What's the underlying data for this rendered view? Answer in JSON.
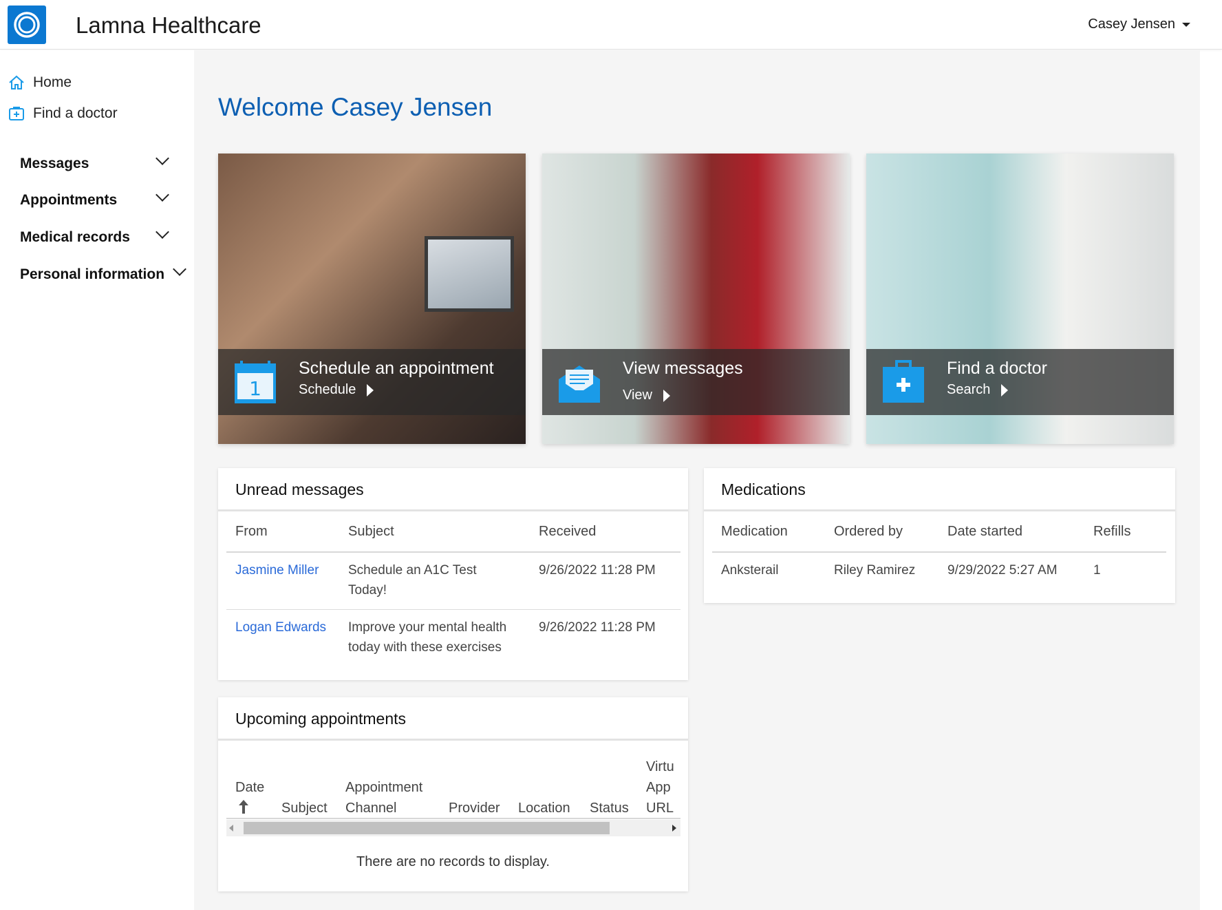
{
  "app": {
    "title": "Lamna Healthcare",
    "user": "Casey Jensen"
  },
  "sidebar": {
    "home": "Home",
    "find_doctor": "Find a doctor",
    "sections": [
      "Messages",
      "Appointments",
      "Medical records",
      "Personal information"
    ]
  },
  "main": {
    "welcome": "Welcome Casey Jensen",
    "tiles": [
      {
        "title": "Schedule an appointment",
        "action": "Schedule"
      },
      {
        "title": "View messages",
        "action": "View"
      },
      {
        "title": "Find a doctor",
        "action": "Search"
      }
    ]
  },
  "unread": {
    "title": "Unread messages",
    "columns": [
      "From",
      "Subject",
      "Received"
    ],
    "rows": [
      {
        "from": "Jasmine Miller",
        "subject_line1": "Schedule an A1C Test",
        "subject_line2": "Today!",
        "received": "9/26/2022 11:28 PM"
      },
      {
        "from": "Logan Edwards",
        "subject_line1": "Improve your mental health",
        "subject_line2": "today with these exercises",
        "received": "9/26/2022 11:28 PM"
      }
    ]
  },
  "medications": {
    "title": "Medications",
    "columns": [
      "Medication",
      "Ordered by",
      "Date started",
      "Refills"
    ],
    "rows": [
      {
        "medication": "Anksterail",
        "ordered_by": "Riley Ramirez",
        "date_started": "9/29/2022 5:27 AM",
        "refills": "1"
      }
    ]
  },
  "appointments": {
    "title": "Upcoming appointments",
    "columns": {
      "date": "Date",
      "subject": "Subject",
      "channel_1": "Appointment",
      "channel_2": "Channel",
      "provider": "Provider",
      "location": "Location",
      "status": "Status",
      "virtual_1": "Virtu",
      "virtual_2": "App",
      "virtual_3": "URL"
    },
    "empty": "There are no records to display."
  },
  "colors": {
    "accent": "#0d5fb2",
    "link": "#2a6ad8",
    "logo": "#0b78d1",
    "tile_icon": "#1a9be8"
  },
  "icons": [
    "logo-rings-icon",
    "home-icon",
    "doctor-kit-icon",
    "chevron-down-icon",
    "calendar-icon",
    "envelope-icon",
    "medical-kit-icon",
    "sort-up-arrow-icon"
  ]
}
